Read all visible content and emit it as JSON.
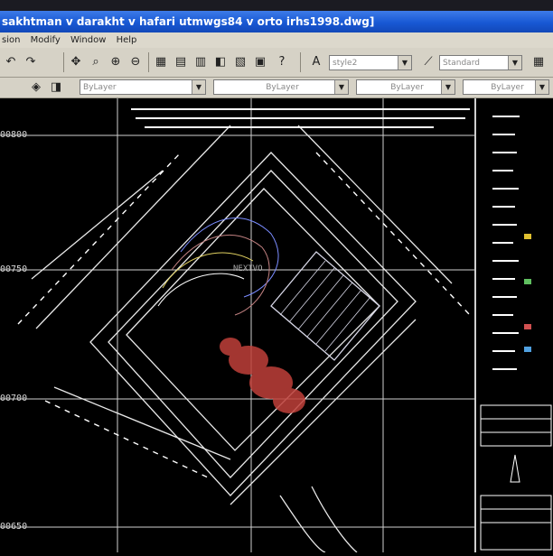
{
  "window": {
    "title": "sakhtman v darakht v hafari utmwgs84 v orto irhs1998.dwg]"
  },
  "menu": [
    "sion",
    "Modify",
    "Window",
    "Help"
  ],
  "toolbar": {
    "text_style": "style2",
    "dim_style": "Standard"
  },
  "layer_bar": {
    "layer": "ByLayer",
    "linetype": "ByLayer",
    "lineweight": "ByLayer",
    "color": "ByLayer"
  },
  "drawing": {
    "y_coords": [
      "00800",
      "00750",
      "00700",
      "00650"
    ],
    "watermark": "NEXTVO"
  },
  "colors": {
    "title_bg": "#1858d4",
    "canvas": "#000000",
    "lines": "#ffffff"
  }
}
